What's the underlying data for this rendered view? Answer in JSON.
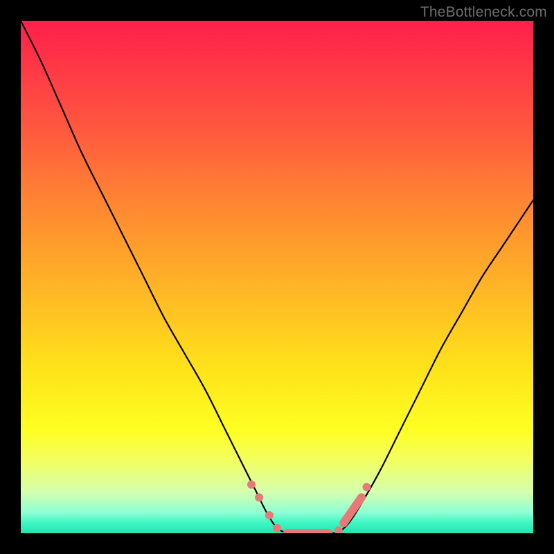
{
  "watermark": "TheBottleneck.com",
  "colors": {
    "frame": "#000000",
    "curve": "#000000",
    "marker": "#e77a78",
    "gradient_top": "#ff1f4c",
    "gradient_bottom": "#27e3ad"
  },
  "chart_data": {
    "type": "line",
    "title": "",
    "xlabel": "",
    "ylabel": "",
    "xlim": [
      0,
      100
    ],
    "ylim": [
      0,
      100
    ],
    "description": "Two black curves descending from the top edges into a flat trough near the bottom center, over a vertical rainbow gradient (red top → green bottom). Bottom = best match (no bottleneck).",
    "series": [
      {
        "name": "left-curve",
        "x": [
          0,
          4,
          8,
          12,
          16,
          20,
          24,
          28,
          32,
          36,
          40,
          44,
          46,
          48,
          50,
          52
        ],
        "y": [
          100,
          92,
          83,
          74,
          66,
          58,
          50,
          42,
          35,
          28,
          20,
          12,
          8,
          4,
          1,
          0
        ]
      },
      {
        "name": "trough",
        "x": [
          52,
          54,
          56,
          58,
          60,
          62
        ],
        "y": [
          0,
          0,
          0,
          0,
          0,
          0
        ]
      },
      {
        "name": "right-curve",
        "x": [
          62,
          64,
          66,
          70,
          74,
          78,
          82,
          86,
          90,
          94,
          98,
          100
        ],
        "y": [
          0,
          2,
          5,
          12,
          20,
          28,
          36,
          43,
          50,
          56,
          62,
          65
        ]
      }
    ],
    "markers": [
      {
        "shape": "circle",
        "x": 45.0,
        "y": 9.5
      },
      {
        "shape": "circle",
        "x": 46.5,
        "y": 7.0
      },
      {
        "shape": "circle",
        "x": 48.5,
        "y": 3.5
      },
      {
        "shape": "circle",
        "x": 50.0,
        "y": 1.0
      },
      {
        "shape": "segment",
        "x0": 52.0,
        "y0": 0.0,
        "x1": 60.0,
        "y1": 0.0
      },
      {
        "shape": "circle",
        "x": 62.0,
        "y": 0.5
      },
      {
        "shape": "segment",
        "x0": 63.0,
        "y0": 2.0,
        "x1": 66.5,
        "y1": 7.0
      },
      {
        "shape": "circle",
        "x": 67.5,
        "y": 9.0
      }
    ]
  }
}
